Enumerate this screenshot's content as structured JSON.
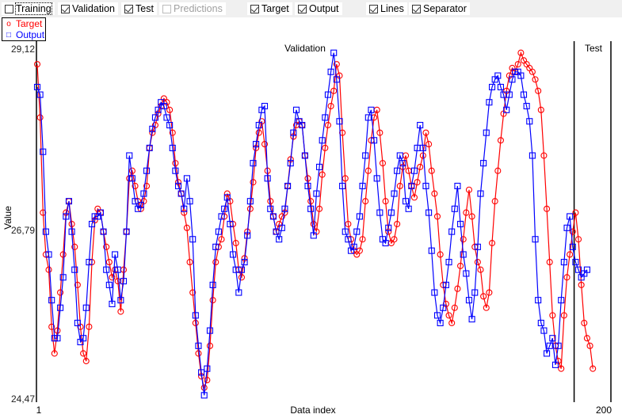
{
  "toolbar": {
    "checkboxes": [
      {
        "label": "Training",
        "checked": false,
        "enabled": true
      },
      {
        "label": "Validation",
        "checked": true,
        "enabled": true
      },
      {
        "label": "Test",
        "checked": true,
        "enabled": true
      },
      {
        "label": "Predictions",
        "checked": false,
        "enabled": false
      },
      {
        "label": "Target",
        "checked": true,
        "enabled": true
      },
      {
        "label": "Output",
        "checked": true,
        "enabled": true
      },
      {
        "label": "Lines",
        "checked": true,
        "enabled": true
      },
      {
        "label": "Separator",
        "checked": true,
        "enabled": true
      }
    ]
  },
  "legend": {
    "target": {
      "label": "Target",
      "symbol": "o",
      "color": "#ff0000"
    },
    "output": {
      "label": "Output",
      "symbol": "□",
      "color": "#0000ff"
    }
  },
  "chart_data": {
    "type": "line",
    "xlabel": "Data index",
    "ylabel": "Value",
    "xlim": [
      1,
      200
    ],
    "ylim": [
      24.47,
      29.12
    ],
    "x_tick_labels": [
      "1",
      "200"
    ],
    "y_tick_labels": [
      "29,12",
      "26,79",
      "24,47"
    ],
    "sections": [
      {
        "label": "Validation",
        "start": 1,
        "end": 187
      },
      {
        "label": "Test",
        "start": 188,
        "end": 200
      }
    ],
    "separator_at": 187.5,
    "series": [
      {
        "name": "Target",
        "color": "#ff0000",
        "marker": "circle",
        "values": [
          28.9,
          28.2,
          26.95,
          26.4,
          26.2,
          25.45,
          25.1,
          25.4,
          25.9,
          26.4,
          26.95,
          27.1,
          26.8,
          26.5,
          26.0,
          25.45,
          25.1,
          25.0,
          25.45,
          26.3,
          26.85,
          27.0,
          26.95,
          26.7,
          26.5,
          26.3,
          26.1,
          26.2,
          26.05,
          25.65,
          26.2,
          26.7,
          27.4,
          27.5,
          27.3,
          27.1,
          27.0,
          27.1,
          27.3,
          27.8,
          28.0,
          28.1,
          28.25,
          28.35,
          28.45,
          28.4,
          28.3,
          28.0,
          27.6,
          27.35,
          27.2,
          26.95,
          26.75,
          26.3,
          25.9,
          25.5,
          25.1,
          24.8,
          24.65,
          24.75,
          25.2,
          25.8,
          26.3,
          26.5,
          26.6,
          26.9,
          27.2,
          27.1,
          26.8,
          26.55,
          26.2,
          26.1,
          26.35,
          26.7,
          27.0,
          27.35,
          27.8,
          28.0,
          28.15,
          27.85,
          27.5,
          27.1,
          26.9,
          26.7,
          26.8,
          26.9,
          26.95,
          27.3,
          27.65,
          27.95,
          28.1,
          28.15,
          28.1,
          27.7,
          27.4,
          27.1,
          26.8,
          26.7,
          27.0,
          27.45,
          27.8,
          28.1,
          28.35,
          28.55,
          28.9,
          28.75,
          28.0,
          27.4,
          26.8,
          26.6,
          26.45,
          26.4,
          26.45,
          26.6,
          27.1,
          27.5,
          27.9,
          28.2,
          28.3,
          28.0,
          27.6,
          27.1,
          26.7,
          26.55,
          26.6,
          26.8,
          27.3,
          27.55,
          27.7,
          27.5,
          27.3,
          27.15,
          27.35,
          27.55,
          27.7,
          28.0,
          27.85,
          27.5,
          27.2,
          26.9,
          26.4,
          26.0,
          25.75,
          25.6,
          25.5,
          25.7,
          25.95,
          26.25,
          26.6,
          26.95,
          27.25,
          26.9,
          26.5,
          26.3,
          26.2,
          25.85,
          25.7,
          25.9,
          26.55,
          27.1,
          27.5,
          27.9,
          28.25,
          28.55,
          28.75,
          28.85,
          28.8,
          28.9,
          29.05,
          28.95,
          28.9,
          28.85,
          28.8,
          28.7,
          28.55,
          28.3,
          27.7,
          27.0,
          26.3,
          25.6,
          25.2,
          25.0,
          24.9,
          25.6,
          26.1,
          26.4,
          26.7,
          26.95,
          26.6,
          26.0,
          25.5,
          25.3,
          25.2,
          24.9
        ]
      },
      {
        "name": "Output",
        "color": "#0000ff",
        "marker": "square",
        "values": [
          28.6,
          28.5,
          27.75,
          26.7,
          26.4,
          25.8,
          25.3,
          25.3,
          25.7,
          26.1,
          26.9,
          27.1,
          26.7,
          26.2,
          25.5,
          25.25,
          25.3,
          25.7,
          26.3,
          26.8,
          26.9,
          26.9,
          26.95,
          26.7,
          26.2,
          26.0,
          25.75,
          26.4,
          26.2,
          25.8,
          26.05,
          26.7,
          27.7,
          27.4,
          27.1,
          27.0,
          27.05,
          27.2,
          27.5,
          27.8,
          28.05,
          28.2,
          28.3,
          28.4,
          28.35,
          28.2,
          28.1,
          27.8,
          27.5,
          27.3,
          27.2,
          27.0,
          27.4,
          27.1,
          26.6,
          25.6,
          25.2,
          24.85,
          24.55,
          24.9,
          25.4,
          26.0,
          26.5,
          26.7,
          26.9,
          27.0,
          27.15,
          26.8,
          26.4,
          26.2,
          25.9,
          26.2,
          26.3,
          26.65,
          27.1,
          27.6,
          27.85,
          28.1,
          28.3,
          28.35,
          27.4,
          27.0,
          26.9,
          26.7,
          26.6,
          26.75,
          27.0,
          27.3,
          27.6,
          28.0,
          28.3,
          28.15,
          28.1,
          27.7,
          27.3,
          27.0,
          26.65,
          27.2,
          27.55,
          27.9,
          28.2,
          28.5,
          28.8,
          29.05,
          28.7,
          28.15,
          27.3,
          26.7,
          26.6,
          26.45,
          26.5,
          26.7,
          26.9,
          27.3,
          27.7,
          28.2,
          28.3,
          27.9,
          27.4,
          26.95,
          26.6,
          26.55,
          26.75,
          26.95,
          27.2,
          27.5,
          27.7,
          27.6,
          27.1,
          27.0,
          27.3,
          27.5,
          27.8,
          28.1,
          27.8,
          27.3,
          26.95,
          26.45,
          25.9,
          25.6,
          25.5,
          25.7,
          26.0,
          26.3,
          26.7,
          27.0,
          27.3,
          26.8,
          26.4,
          26.15,
          25.8,
          25.55,
          25.9,
          26.5,
          27.2,
          27.6,
          28.0,
          28.4,
          28.6,
          28.7,
          28.75,
          28.6,
          28.5,
          28.3,
          28.5,
          28.7,
          28.8,
          28.8,
          28.75,
          28.5,
          28.35,
          28.15,
          27.7,
          26.6,
          25.8,
          25.5,
          25.4,
          25.1,
          25.2,
          25.3,
          24.95,
          25.2,
          25.8,
          26.3,
          26.75,
          26.9,
          26.5,
          26.3,
          26.2,
          26.1,
          26.15,
          26.2
        ]
      }
    ]
  }
}
